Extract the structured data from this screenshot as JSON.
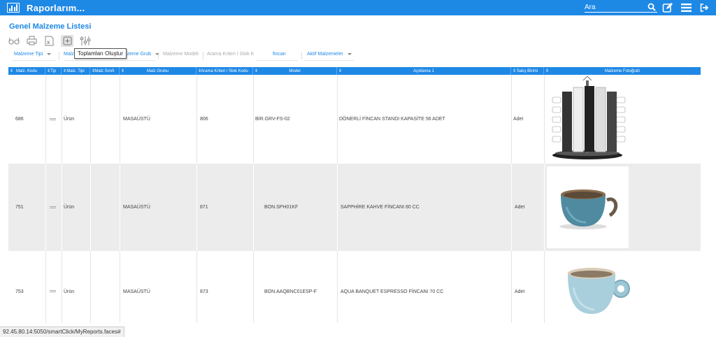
{
  "app": {
    "title": "Raporlarım..."
  },
  "search": {
    "placeholder": "Ara"
  },
  "page": {
    "title": "Genel Malzeme Listesi"
  },
  "tooltip": {
    "text": "Toplamları Oluştur"
  },
  "filters": {
    "malzeme_tipi": "Malzeme Tipi",
    "malz_partial": "Malz",
    "malzeme_grubu_partial": "alzeme Grub",
    "malzeme_modeli": "Malzeme Modeli",
    "arama_kriteri": "Arama Kriteri / Stok K",
    "search_value": "fincan",
    "aktif": "Aktif Malzemeler"
  },
  "table": {
    "columns": [
      "Malz. Kodu",
      "Tip",
      "Malz. Tipi",
      "Malz Sınıfı",
      "Malz Grubu",
      "Arama Kriteri / Stok Kodu",
      "Model",
      "Açıklama 1",
      "Satış Birimi",
      "Malzeme Fotoğrafı"
    ],
    "rows": [
      {
        "kod": "686",
        "tip": "Ürün",
        "grup": "MASAÜSTÜ",
        "stok": "806",
        "model": "BİR.GRV-FS-02",
        "aciklama": "DÖNERLİ FİNCAN STANDI KAPASİTE 56 ADET",
        "birim": "Adet",
        "photo": "rotating-cup-stand"
      },
      {
        "kod": "751",
        "tip": "Ürün",
        "grup": "MASAÜSTÜ",
        "stok": "871",
        "model": "BON.SPH01KF",
        "aciklama": "SAPPHİRE KAHVE FİNCANI 80 CC",
        "birim": "Adet",
        "photo": "blue-coffee-cup"
      },
      {
        "kod": "753",
        "tip": "Ürün",
        "grup": "MASAÜSTÜ",
        "stok": "873",
        "model": "BON.AAQBNC01ESP-F",
        "aciklama": "AQUA BANQUET ESPRESSO FİNCANI 70 CC",
        "birim": "Adet",
        "photo": "aqua-espresso-cup"
      }
    ]
  },
  "status": {
    "url": "92.45.80.14:5050/smartClick/MyReports.faces#"
  },
  "colors": {
    "accent": "#1e88e5",
    "header_bg": "#1e88e5",
    "row_alt": "#ececec"
  }
}
